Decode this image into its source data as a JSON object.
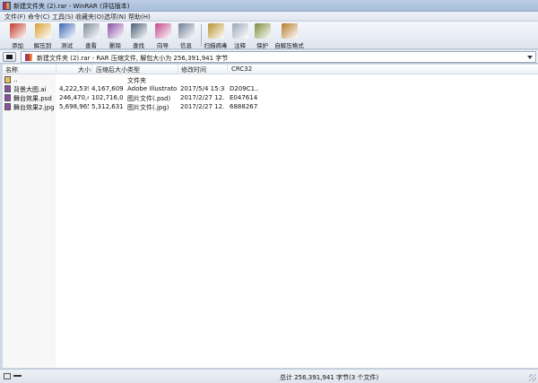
{
  "window": {
    "title": "新建文件夹 (2).rar - WinRAR (评估版本)"
  },
  "menu": [
    {
      "label": "文件(F)"
    },
    {
      "label": "命令(C)"
    },
    {
      "label": "工具(S)"
    },
    {
      "label": "收藏夹(O)"
    },
    {
      "label": "选项(N)"
    },
    {
      "label": "帮助(H)"
    }
  ],
  "toolbar": [
    {
      "label": "添加",
      "icon": "add-books-icon",
      "color": "#c0392b"
    },
    {
      "label": "解压到",
      "icon": "extract-folder-icon",
      "color": "#d8a032"
    },
    {
      "label": "测试",
      "icon": "test-icon",
      "color": "#3a66b5"
    },
    {
      "label": "查看",
      "icon": "view-glasses-icon",
      "color": "#7d8a99"
    },
    {
      "label": "删除",
      "icon": "delete-icon",
      "color": "#8a4fa3"
    },
    {
      "label": "查找",
      "icon": "find-binoculars-icon",
      "color": "#4a5d74"
    },
    {
      "label": "向导",
      "icon": "wizard-icon",
      "color": "#c2478c"
    },
    {
      "label": "信息",
      "icon": "info-icon",
      "color": "#6d7f94"
    },
    {
      "label": "扫描病毒",
      "icon": "virus-scan-icon",
      "color": "#b8912e"
    },
    {
      "label": "注释",
      "icon": "comment-icon",
      "color": "#9aa7b5"
    },
    {
      "label": "保护",
      "icon": "protect-shield-icon",
      "color": "#7b8a3c"
    },
    {
      "label": "自解压格式",
      "icon": "sfx-icon",
      "color": "#b57a2a"
    }
  ],
  "path": {
    "text": "新建文件夹 (2).rar - RAR 压缩文件, 解包大小为 256,391,941 字节"
  },
  "columns": [
    "名称",
    "大小",
    "压缩后大小",
    "类型",
    "修改时间",
    "CRC32"
  ],
  "rows": [
    {
      "name": "..",
      "size": "",
      "packed": "",
      "type": "文件夹",
      "modified": "",
      "crc": "",
      "icon": "parent-folder-icon",
      "icon_color": "#e8c05a"
    },
    {
      "name": "背景大图.ai",
      "size": "4,222,539",
      "packed": "4,167,609",
      "type": "Adobe Illustrator...",
      "modified": "2017/5/4 15:38",
      "crc": "D209C1...",
      "icon": "ai-file-icon",
      "icon_color": "#8a4fa3"
    },
    {
      "name": "舞台效果.psd",
      "size": "246,470,4...",
      "packed": "102,716,0...",
      "type": "图片文件(.psd)",
      "modified": "2017/2/27 12...",
      "crc": "E0476143",
      "icon": "psd-file-icon",
      "icon_color": "#8a4fa3"
    },
    {
      "name": "舞台效果2.jpg",
      "size": "5,698,965",
      "packed": "5,312,631",
      "type": "图片文件(.jpg)",
      "modified": "2017/2/27 12...",
      "crc": "68882672",
      "icon": "jpg-file-icon",
      "icon_color": "#8a4fa3"
    }
  ],
  "status": {
    "text": "总计 256,391,941 字节(3 个文件)"
  }
}
